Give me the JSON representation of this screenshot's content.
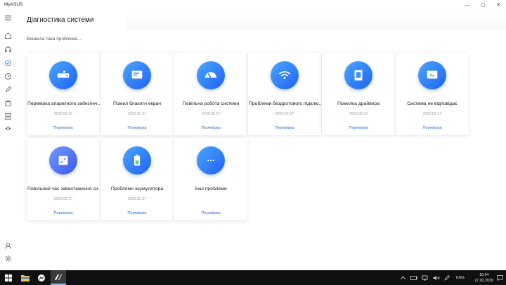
{
  "app": {
    "title": "MyASUS"
  },
  "window_controls": {
    "minimize": "—",
    "maximize": "▢",
    "close": "✕"
  },
  "header": {
    "title": "Діагностика системи",
    "subtitle": "Виникла така проблема..."
  },
  "cards": [
    {
      "label": "Перевірка апаратного забезпеч...",
      "date": "2020.02.27",
      "action": "Перевірка",
      "icon": "hard-drive-icon"
    },
    {
      "label": "Помил блакитн екран",
      "date": "2020.02.27",
      "action": "Перевірка",
      "icon": "blue-screen-icon"
    },
    {
      "label": "Повільна робота системи",
      "date": "2020.02.27",
      "action": "Перевірка",
      "icon": "speedometer-icon"
    },
    {
      "label": "Проблеми бездротового підклю...",
      "date": "2020.02.27",
      "action": "Перевірка",
      "icon": "wifi-icon"
    },
    {
      "label": "Помилка драйвера",
      "date": "2020.02.27",
      "action": "Перевірка",
      "icon": "driver-icon"
    },
    {
      "label": "Система не відповідає",
      "date": "2020.02.27",
      "action": "Перевірка",
      "icon": "not-responding-icon"
    },
    {
      "label": "Повільний час завантаження си...",
      "date": "2020.02.27",
      "action": "Перевірка",
      "icon": "boot-icon"
    },
    {
      "label": "Проблеми акумулятора",
      "date": "2020.02.27",
      "action": "Перевірка",
      "icon": "battery-icon"
    },
    {
      "label": "Інші проблеми",
      "date": "",
      "action": "Перевірка",
      "icon": "more-icon"
    }
  ],
  "sidebar": {
    "items": [
      {
        "icon": "menu-icon"
      },
      {
        "icon": "home-icon"
      },
      {
        "icon": "support-icon"
      },
      {
        "icon": "diagnostics-icon"
      },
      {
        "icon": "recovery-icon"
      },
      {
        "icon": "rocket-icon"
      },
      {
        "icon": "store-icon"
      },
      {
        "icon": "news-icon"
      },
      {
        "icon": "link-icon"
      },
      {
        "icon": "user-icon"
      },
      {
        "icon": "settings-icon"
      }
    ]
  },
  "taskbar": {
    "language": "ENG",
    "time": "16:54",
    "date": "27.02.2020"
  },
  "colors": {
    "accent": "#2f6ee0",
    "circle_start": "#4aa6ff",
    "circle_end": "#2062f0",
    "taskbar": "#101010"
  }
}
